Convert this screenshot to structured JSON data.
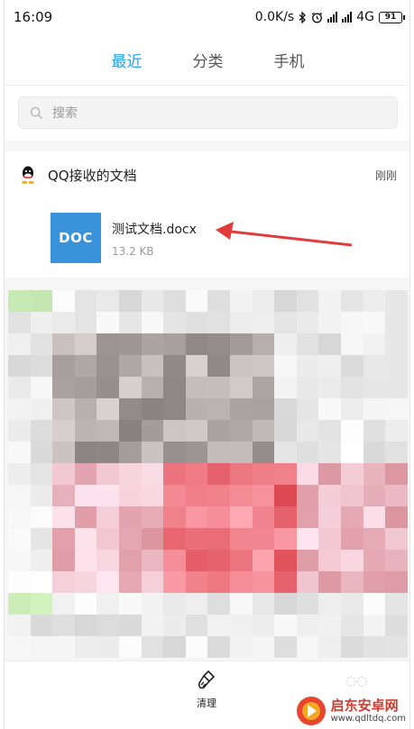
{
  "status_bar": {
    "time": "16:09",
    "network_speed": "0.0K/s",
    "network_type": "4G",
    "battery": "91",
    "icons": [
      "bluetooth-icon",
      "alarm-icon",
      "signal-icon",
      "wifi-icon",
      "battery-icon"
    ]
  },
  "tabs": [
    {
      "label": "最近",
      "active": true
    },
    {
      "label": "分类",
      "active": false
    },
    {
      "label": "手机",
      "active": false
    }
  ],
  "search": {
    "placeholder": "搜索",
    "icon": "search-icon"
  },
  "section": {
    "icon": "qq-icon",
    "title": "QQ接收的文档",
    "time": "刚刚"
  },
  "file": {
    "type_label": "DOC",
    "name": "测试文档.docx",
    "size": "13.2 KB"
  },
  "annotation": {
    "icon": "arrow-icon",
    "color": "#e23b3b"
  },
  "bottom_bar": {
    "clean_label": "清理",
    "clean_icon": "brush-icon"
  },
  "watermark": {
    "title": "启东安卓网",
    "url": "www.qdltdq.com"
  },
  "colors": {
    "accent": "#2aa1e2",
    "doc_icon": "#3a92db",
    "arrow": "#e23b3b",
    "watermark": "#d13a2f"
  }
}
